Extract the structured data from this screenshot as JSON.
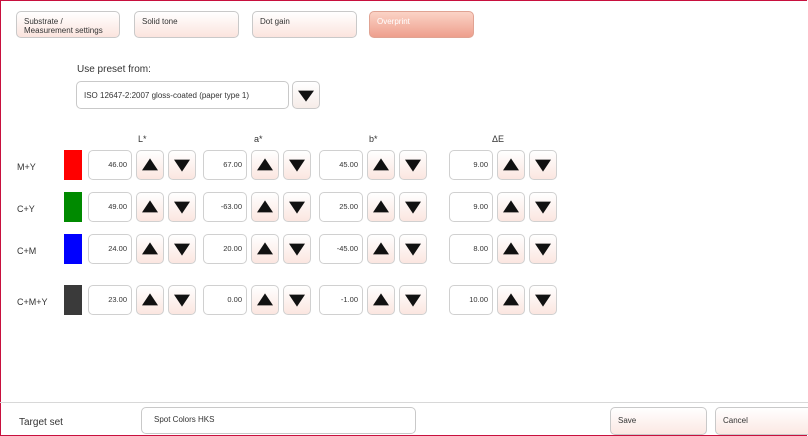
{
  "tabs": [
    {
      "label": "Substrate /\nMeasurement settings"
    },
    {
      "label": "Solid tone"
    },
    {
      "label": "Dot gain"
    },
    {
      "label": "Overprint"
    }
  ],
  "preset": {
    "label": "Use preset from:",
    "value": "ISO 12647-2:2007 gloss-coated (paper type 1)"
  },
  "columns": [
    "L*",
    "a*",
    "b*",
    "ΔE"
  ],
  "rows": [
    {
      "name": "M+Y",
      "color": "#ff0000",
      "values": [
        "46.00",
        "67.00",
        "45.00",
        "9.00"
      ]
    },
    {
      "name": "C+Y",
      "color": "#008a00",
      "values": [
        "49.00",
        "-63.00",
        "25.00",
        "9.00"
      ]
    },
    {
      "name": "C+M",
      "color": "#0000ff",
      "values": [
        "24.00",
        "20.00",
        "-45.00",
        "8.00"
      ]
    },
    {
      "name": "C+M+Y",
      "color": "#3a3a3a",
      "values": [
        "23.00",
        "0.00",
        "-1.00",
        "10.00"
      ]
    }
  ],
  "footer": {
    "target_label": "Target set",
    "target_value": "Spot Colors HKS",
    "save_label": "Save",
    "cancel_label": "Cancel"
  },
  "colors": {
    "accent": "#c8103e",
    "active_tab": "#ee9f8d"
  }
}
